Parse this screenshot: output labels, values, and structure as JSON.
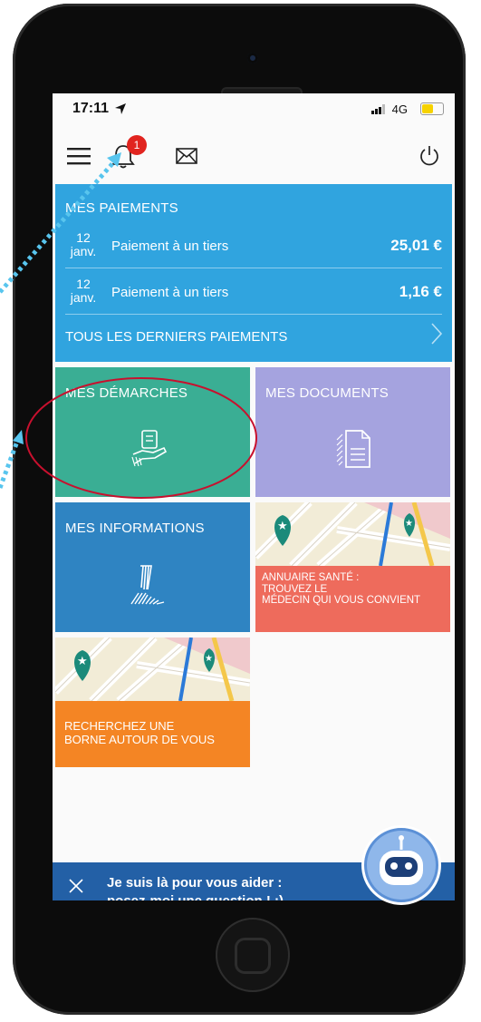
{
  "status_bar": {
    "time": "17:11",
    "network": "4G"
  },
  "topbar": {
    "notification_count": "1"
  },
  "payments": {
    "title": "MES PAIEMENTS",
    "items": [
      {
        "day": "12",
        "month": "janv.",
        "label": "Paiement à un tiers",
        "amount": "25,01 €"
      },
      {
        "day": "12",
        "month": "janv.",
        "label": "Paiement à un tiers",
        "amount": "1,16 €"
      }
    ],
    "all_link": "TOUS LES DERNIERS PAIEMENTS"
  },
  "tiles": {
    "demarches": "MES DÉMARCHES",
    "documents": "MES DOCUMENTS",
    "informations": "MES INFORMATIONS",
    "annuaire": [
      "ANNUAIRE SANTÉ :",
      "TROUVEZ LE",
      "MÉDECIN QUI VOUS CONVIENT"
    ],
    "borne": [
      "RECHERCHEZ UNE",
      "BORNE AUTOUR DE VOUS"
    ]
  },
  "assistant": {
    "line1": "Je suis là pour vous aider :",
    "line2": "posez-moi une question ! :)"
  },
  "colors": {
    "payments_bg": "#30a4df",
    "demarches_bg": "#3aae94",
    "documents_bg": "#a5a3df",
    "informations_bg": "#2f84c2",
    "annuaire_bg": "#ee6b5c",
    "borne_bg": "#f48524",
    "banner_bg": "#2360a6",
    "badge": "#e1241f",
    "annotation_circle": "#c8102e",
    "annotation_arrow": "#58c5ee"
  }
}
